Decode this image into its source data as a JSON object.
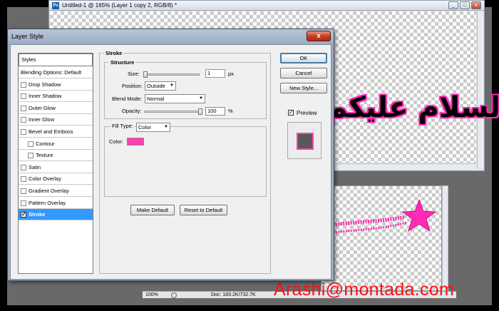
{
  "document1": {
    "title": "Untitled-1 @ 165% (Layer 1 copy 2, RGB/8) *",
    "app_icon": "Ps",
    "window_buttons": [
      "_",
      "□",
      "x"
    ],
    "canvas_text": "السلام عليكم"
  },
  "document2": {
    "zoom": "100%",
    "doc_info": "Doc: 183.2K/732.7K",
    "stroke_color": "#ff2bb5"
  },
  "dialog": {
    "title": "Layer Style",
    "close_label": "x",
    "styles_header": "Styles",
    "styles": [
      {
        "label": "Blending Options: Default",
        "has_checkbox": false,
        "checked": false,
        "selected": false
      },
      {
        "label": "Drop Shadow",
        "has_checkbox": true,
        "checked": false,
        "selected": false
      },
      {
        "label": "Inner Shadow",
        "has_checkbox": true,
        "checked": false,
        "selected": false
      },
      {
        "label": "Outer Glow",
        "has_checkbox": true,
        "checked": false,
        "selected": false
      },
      {
        "label": "Inner Glow",
        "has_checkbox": true,
        "checked": false,
        "selected": false
      },
      {
        "label": "Bevel and Emboss",
        "has_checkbox": true,
        "checked": false,
        "selected": false
      },
      {
        "label": "Contour",
        "has_checkbox": true,
        "checked": false,
        "selected": false
      },
      {
        "label": "Texture",
        "has_checkbox": true,
        "checked": false,
        "selected": false
      },
      {
        "label": "Satin",
        "has_checkbox": true,
        "checked": false,
        "selected": false
      },
      {
        "label": "Color Overlay",
        "has_checkbox": true,
        "checked": false,
        "selected": false
      },
      {
        "label": "Gradient Overlay",
        "has_checkbox": true,
        "checked": false,
        "selected": false
      },
      {
        "label": "Pattern Overlay",
        "has_checkbox": true,
        "checked": false,
        "selected": false
      },
      {
        "label": "Stroke",
        "has_checkbox": true,
        "checked": true,
        "selected": true
      }
    ],
    "stroke": {
      "group_label": "Stroke",
      "structure_label": "Structure",
      "size_label": "Size:",
      "size_value": "1",
      "size_unit": "px",
      "position_label": "Position:",
      "position_value": "Outside",
      "blend_mode_label": "Blend Mode:",
      "blend_mode_value": "Normal",
      "opacity_label": "Opacity:",
      "opacity_value": "100",
      "opacity_unit": "%",
      "fill_type_label": "Fill Type:",
      "fill_type_value": "Color",
      "color_label": "Color:",
      "color_value": "#ff3fb2",
      "make_default_label": "Make Default",
      "reset_label": "Reset to Default"
    },
    "buttons": {
      "ok": "OK",
      "cancel": "Cancel",
      "new_style": "New Style..."
    },
    "preview": {
      "label": "Preview",
      "checked": true
    }
  },
  "watermark": "Arashi@montada.com"
}
